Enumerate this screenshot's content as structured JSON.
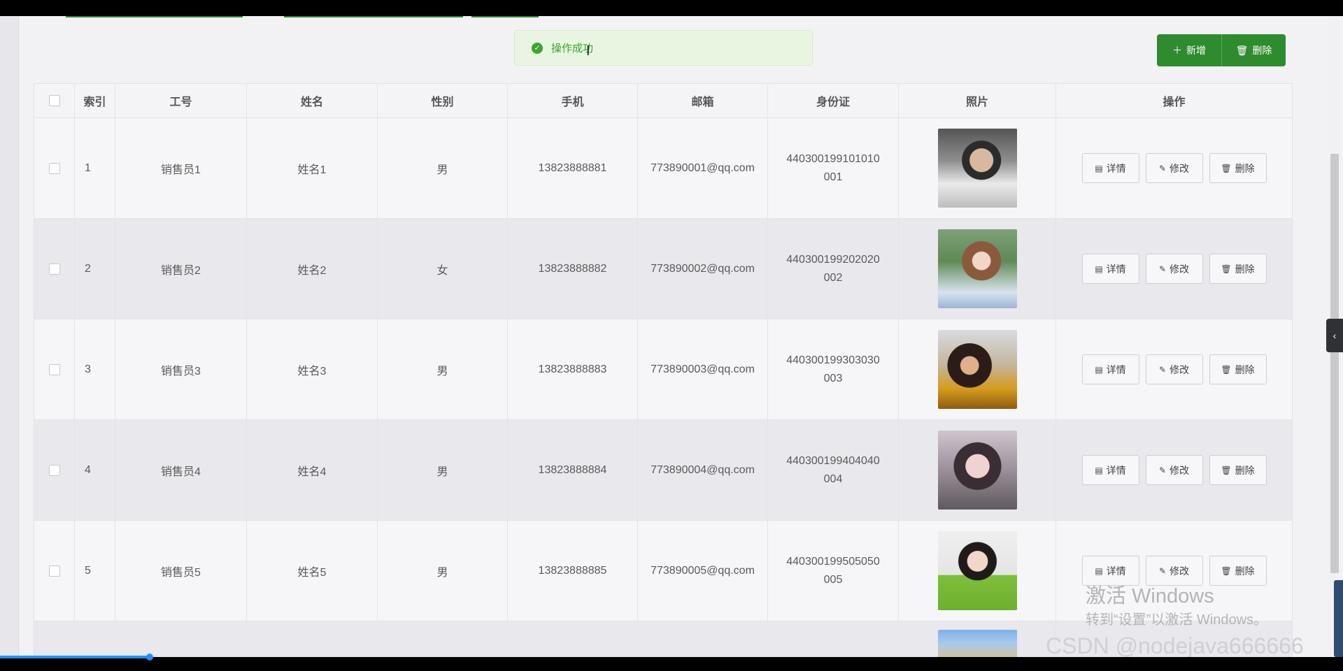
{
  "toast": {
    "message": "操作成功"
  },
  "toolbar": {
    "add_label": "新增",
    "delete_label": "删除"
  },
  "table": {
    "headers": [
      "索引",
      "工号",
      "姓名",
      "性别",
      "手机",
      "邮箱",
      "身份证",
      "照片",
      "操作"
    ],
    "rows": [
      {
        "index": "1",
        "no": "销售员1",
        "name": "姓名1",
        "sex": "男",
        "phone": "13823888881",
        "email": "773890001@qq.com",
        "idcard": "440300199101010001"
      },
      {
        "index": "2",
        "no": "销售员2",
        "name": "姓名2",
        "sex": "女",
        "phone": "13823888882",
        "email": "773890002@qq.com",
        "idcard": "440300199202020002"
      },
      {
        "index": "3",
        "no": "销售员3",
        "name": "姓名3",
        "sex": "男",
        "phone": "13823888883",
        "email": "773890003@qq.com",
        "idcard": "440300199303030003"
      },
      {
        "index": "4",
        "no": "销售员4",
        "name": "姓名4",
        "sex": "男",
        "phone": "13823888884",
        "email": "773890004@qq.com",
        "idcard": "440300199404040004"
      },
      {
        "index": "5",
        "no": "销售员5",
        "name": "姓名5",
        "sex": "男",
        "phone": "13823888885",
        "email": "773890005@qq.com",
        "idcard": "440300199505050005"
      }
    ],
    "actions": {
      "detail": "详情",
      "edit": "修改",
      "delete": "删除"
    }
  },
  "watermark": {
    "activate_title": "激活 Windows",
    "activate_hint": "转到“设置”以激活 Windows。",
    "csdn": "CSDN @nodejava666666"
  },
  "colors": {
    "primary": "#2e8b2e",
    "success": "#3aa52a"
  },
  "icons": [
    "check-circle-icon",
    "plus-icon",
    "trash-icon",
    "document-icon",
    "edit-icon",
    "chevron-left-icon"
  ]
}
